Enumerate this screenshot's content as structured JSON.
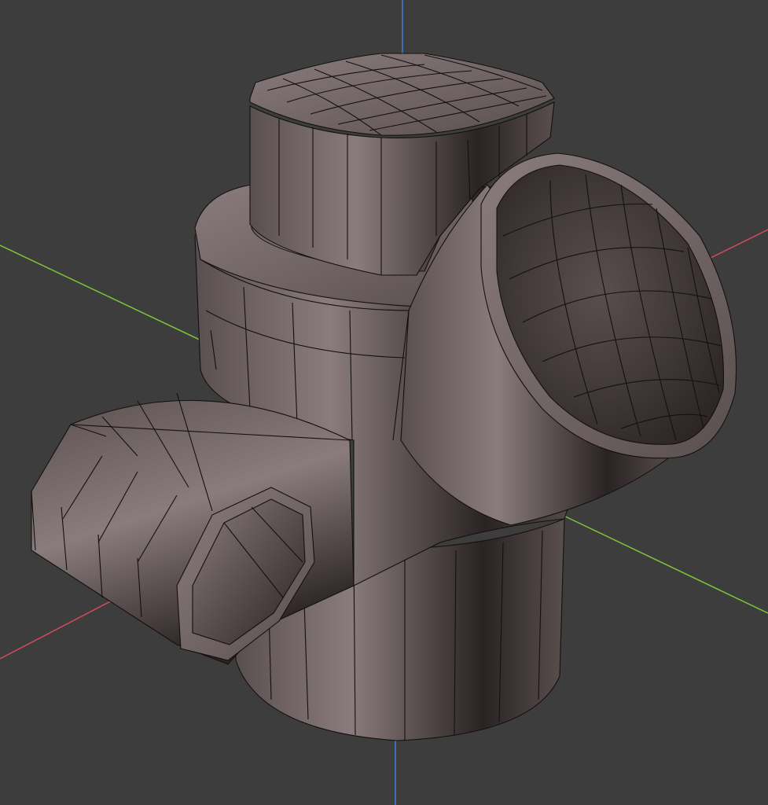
{
  "viewport": {
    "background": "#3d3d3d",
    "axes": {
      "x_color": "#d84a5c",
      "y_color": "#7ec43a",
      "z_color": "#3f7fdc"
    },
    "mesh": {
      "shade_light": "#8a7c7c",
      "shade_mid": "#5a4f4f",
      "shade_dark": "#2a2323",
      "wire_color": "#141010"
    }
  }
}
